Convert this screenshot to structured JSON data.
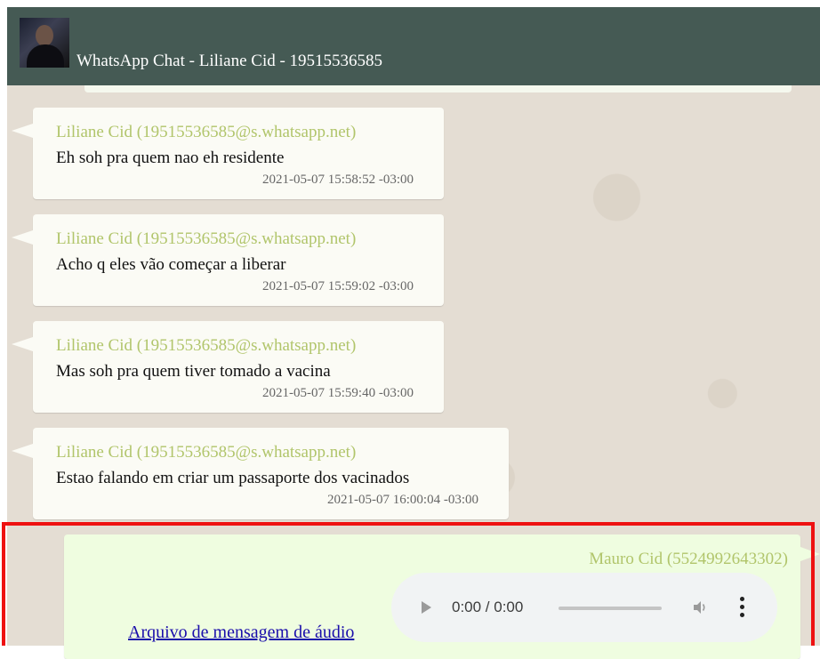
{
  "header": {
    "title": "WhatsApp Chat - Liliane Cid - 19515536585"
  },
  "messages": [
    {
      "sender": "Liliane Cid (19515536585@s.whatsapp.net)",
      "text": "Eh soh pra quem nao eh residente",
      "time": "2021-05-07 15:58:52 -03:00"
    },
    {
      "sender": "Liliane Cid (19515536585@s.whatsapp.net)",
      "text": "Acho q eles vão começar a liberar",
      "time": "2021-05-07 15:59:02 -03:00"
    },
    {
      "sender": "Liliane Cid (19515536585@s.whatsapp.net)",
      "text": "Mas soh pra quem tiver tomado a vacina",
      "time": "2021-05-07 15:59:40 -03:00"
    },
    {
      "sender": "Liliane Cid (19515536585@s.whatsapp.net)",
      "text": "Estao falando em criar um passaporte dos vacinados",
      "time": "2021-05-07 16:00:04 -03:00"
    }
  ],
  "outgoing": {
    "sender": "Mauro Cid (5524992643302)",
    "audio_time": "0:00 / 0:00",
    "file_link": "Arquivo de mensagem de áudio"
  },
  "colors": {
    "header_bg": "#455a54",
    "sender_name": "#b1c56b",
    "highlight_border": "#ee1111",
    "outgoing_bubble": "#effde0"
  },
  "icons": {
    "play": "play-icon",
    "volume": "volume-icon",
    "menu": "more-vert-icon"
  }
}
